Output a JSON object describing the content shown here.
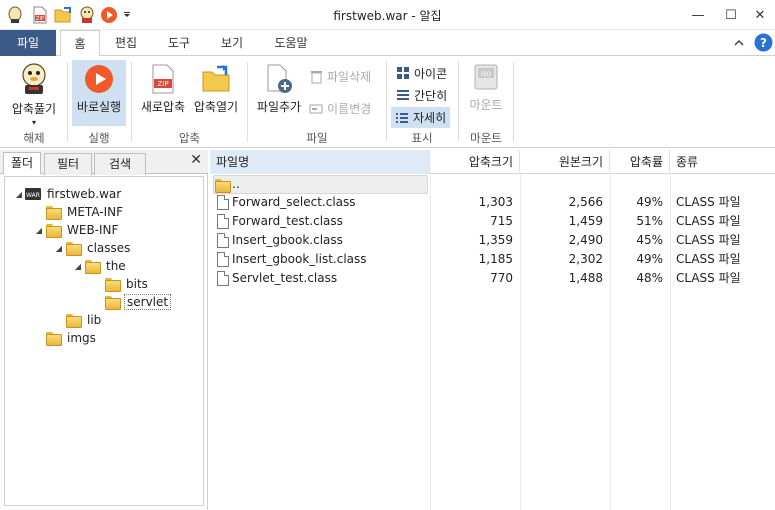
{
  "window": {
    "title": "firstweb.war - 알집",
    "controls": [
      "—",
      "☐",
      "✕"
    ]
  },
  "quick_access": [
    "app-icon",
    "zip-icon",
    "open-folder-icon",
    "extract-icon",
    "run-icon",
    "dropdown-arrow-icon"
  ],
  "menu_tabs": [
    {
      "label": "파일"
    },
    {
      "label": "홈"
    },
    {
      "label": "편집"
    },
    {
      "label": "도구"
    },
    {
      "label": "보기"
    },
    {
      "label": "도움말"
    }
  ],
  "ribbon": {
    "extract_label": "압축풀기",
    "extract_group": "해제",
    "run_label": "바로실행",
    "run_group": "실행",
    "new_zip_label": "새로압축",
    "open_zip_label": "압축열기",
    "zip_group": "압축",
    "add_file_label": "파일추가",
    "delete_file_label": "파일삭제",
    "rename_label": "이름변경",
    "file_group": "파일",
    "view_icon_label": "아이콘",
    "view_simple_label": "간단히",
    "view_detail_label": "자세히",
    "view_group": "표시",
    "mount_label": "마운트",
    "mount_group": "마운트",
    "iso_badge": "ISO",
    "zip_badge": "ZIP"
  },
  "left_panel": {
    "tabs": [
      "폴더",
      "필터",
      "검색"
    ],
    "close": "✕",
    "tree": [
      {
        "label": "firstweb.war",
        "badge": "WAR"
      },
      {
        "label": "META-INF"
      },
      {
        "label": "WEB-INF"
      },
      {
        "label": "classes"
      },
      {
        "label": "the"
      },
      {
        "label": "bits"
      },
      {
        "label": "servlet"
      },
      {
        "label": "lib"
      },
      {
        "label": "imgs"
      }
    ]
  },
  "file_list": {
    "columns": [
      "파일명",
      "압축크기",
      "원본크기",
      "압축률",
      "종류"
    ],
    "updir": "..",
    "rows": [
      {
        "name": "Forward_select.class",
        "packed": "1,303",
        "original": "2,566",
        "ratio": "49%",
        "type": "CLASS 파일"
      },
      {
        "name": "Forward_test.class",
        "packed": "715",
        "original": "1,459",
        "ratio": "51%",
        "type": "CLASS 파일"
      },
      {
        "name": "Insert_gbook.class",
        "packed": "1,359",
        "original": "2,490",
        "ratio": "45%",
        "type": "CLASS 파일"
      },
      {
        "name": "Insert_gbook_list.class",
        "packed": "1,185",
        "original": "2,302",
        "ratio": "49%",
        "type": "CLASS 파일"
      },
      {
        "name": "Servlet_test.class",
        "packed": "770",
        "original": "1,488",
        "ratio": "48%",
        "type": "CLASS 파일"
      }
    ]
  },
  "colors": {
    "file_tab": "#3b5a87",
    "pressed": "#cfe0f3",
    "run_red": "#f05a2a",
    "folder_yellow": "#f2c94c",
    "help_blue": "#2a72d4"
  }
}
